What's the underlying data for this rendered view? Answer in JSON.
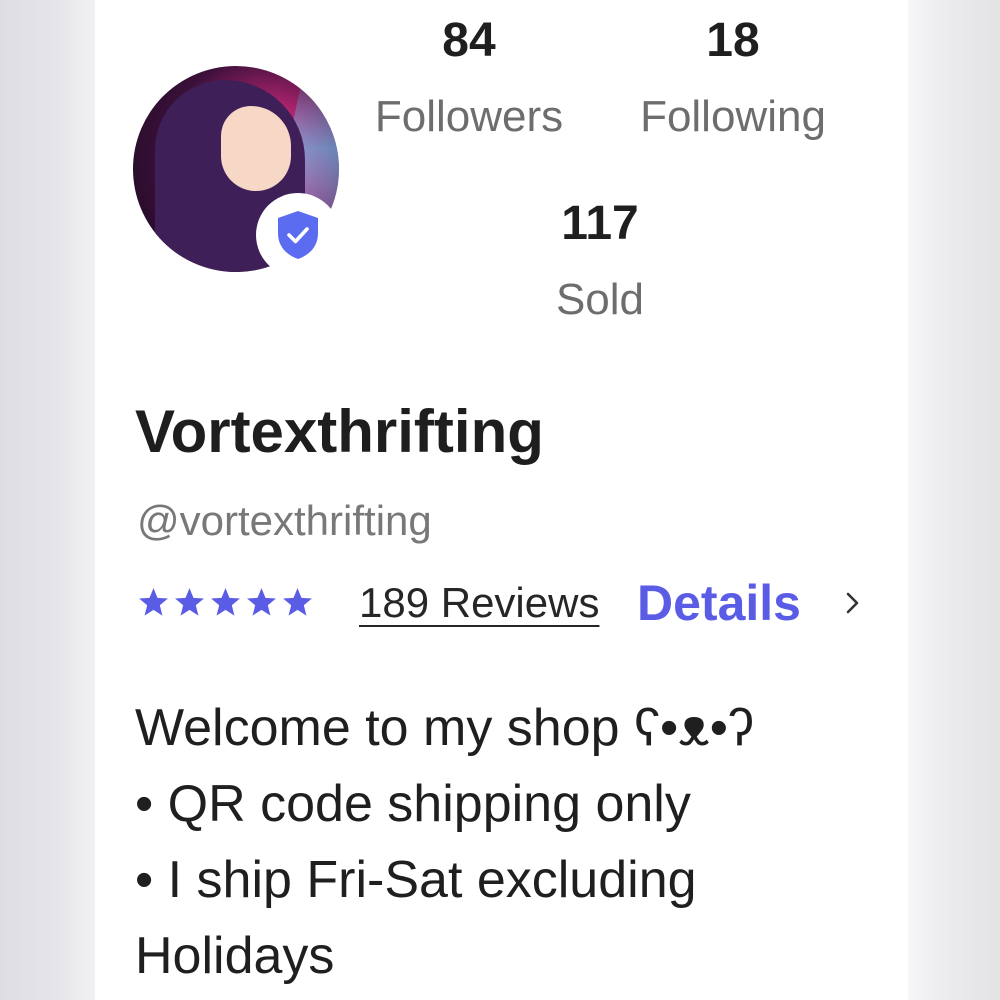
{
  "profile": {
    "stats": {
      "followers": {
        "count": "84",
        "label": "Followers"
      },
      "following": {
        "count": "18",
        "label": "Following"
      },
      "sold": {
        "count": "117",
        "label": "Sold"
      }
    },
    "name": "Vortexthrifting",
    "handle": "@vortexthrifting",
    "rating": {
      "stars": 5,
      "max_stars": 5,
      "reviews_text": "189 Reviews",
      "details_label": "Details"
    },
    "verified": true,
    "bio": [
      "Welcome to my shop ʕ•ᴥ•ʔ",
      "• QR code shipping only",
      "• I ship Fri-Sat excluding",
      "Holidays"
    ]
  },
  "colors": {
    "accent": "#5b5ce6",
    "text": "#1f1f1f",
    "muted": "#6d6d6d"
  },
  "icons": {
    "badge": "verified-shield-icon",
    "chevron": "chevron-right-icon",
    "star": "star-icon"
  }
}
